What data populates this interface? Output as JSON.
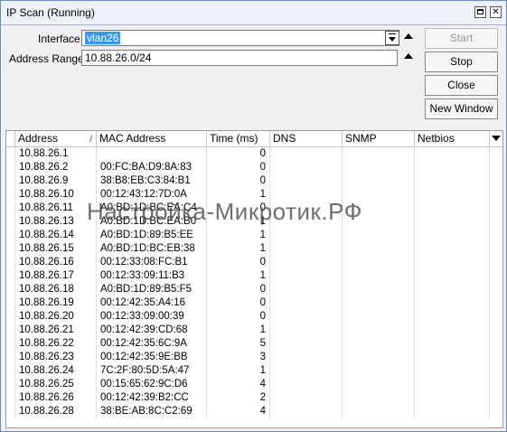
{
  "window": {
    "title": "IP Scan (Running)"
  },
  "form": {
    "interface_label": "Interface:",
    "interface_value": "vlan26",
    "range_label": "Address Range:",
    "range_value": "10.88.26.0/24"
  },
  "buttons": {
    "start": "Start",
    "stop": "Stop",
    "close": "Close",
    "new_window": "New Window"
  },
  "table": {
    "columns": [
      "Address",
      "MAC Address",
      "Time (ms)",
      "DNS",
      "SNMP",
      "Netbios"
    ],
    "rows": [
      [
        "10.88.26.1",
        "",
        "0",
        "",
        "",
        ""
      ],
      [
        "10.88.26.2",
        "00:FC:BA:D9:8A:83",
        "0",
        "",
        "",
        ""
      ],
      [
        "10.88.26.9",
        "38:B8:EB:C3:84:B1",
        "0",
        "",
        "",
        ""
      ],
      [
        "10.88.26.10",
        "00:12:43:12:7D:0A",
        "1",
        "",
        "",
        ""
      ],
      [
        "10.88.26.11",
        "A0:BD:1D:BC:EA:C4",
        "0",
        "",
        "",
        ""
      ],
      [
        "10.88.26.13",
        "A0:BD:1D:BC:EA:B0",
        "1",
        "",
        "",
        ""
      ],
      [
        "10.88.26.14",
        "A0:BD:1D:89:B5:EE",
        "1",
        "",
        "",
        ""
      ],
      [
        "10.88.26.15",
        "A0:BD:1D:BC:EB:38",
        "1",
        "",
        "",
        ""
      ],
      [
        "10.88.26.16",
        "00:12:33:08:FC:B1",
        "0",
        "",
        "",
        ""
      ],
      [
        "10.88.26.17",
        "00:12:33:09:11:B3",
        "1",
        "",
        "",
        ""
      ],
      [
        "10.88.26.18",
        "A0:BD:1D:89:B5:F5",
        "0",
        "",
        "",
        ""
      ],
      [
        "10.88.26.19",
        "00:12:42:35:A4:16",
        "0",
        "",
        "",
        ""
      ],
      [
        "10.88.26.20",
        "00:12:33:09:00:39",
        "0",
        "",
        "",
        ""
      ],
      [
        "10.88.26.21",
        "00:12:42:39:CD:68",
        "1",
        "",
        "",
        ""
      ],
      [
        "10.88.26.22",
        "00:12:42:35:6C:9A",
        "5",
        "",
        "",
        ""
      ],
      [
        "10.88.26.23",
        "00:12:42:35:9E:BB",
        "3",
        "",
        "",
        ""
      ],
      [
        "10.88.26.24",
        "7C:2F:80:5D:5A:47",
        "1",
        "",
        "",
        ""
      ],
      [
        "10.88.26.25",
        "00:15:65:62:9C:D6",
        "4",
        "",
        "",
        ""
      ],
      [
        "10.88.26.26",
        "00:12:42:39:B2:CC",
        "2",
        "",
        "",
        ""
      ],
      [
        "10.88.26.28",
        "38:BE:AB:8C:C2:69",
        "4",
        "",
        "",
        ""
      ]
    ]
  },
  "watermark": "Настройка-Микротик.РФ",
  "icons": {
    "maximize": "maximize-icon",
    "close": "close-icon",
    "dropdown": "dropdown-icon",
    "up": "up-arrow-icon",
    "sort": "sort-icon",
    "column_menu": "column-menu-icon"
  }
}
